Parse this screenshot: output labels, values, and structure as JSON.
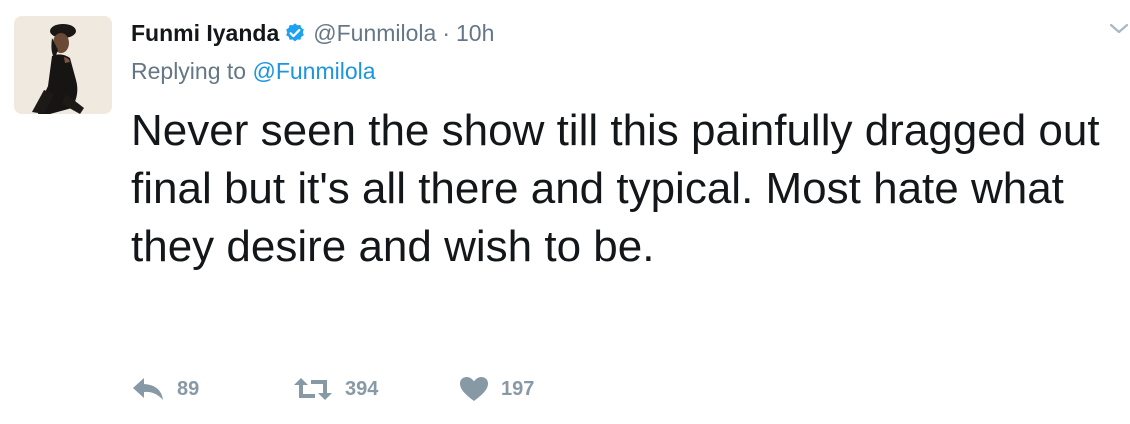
{
  "author": {
    "name": "Funmi Iyanda",
    "handle": "@Funmilola",
    "time": "10h",
    "verified": true
  },
  "reply_context": {
    "prefix": "Replying to",
    "mention": "@Funmilola"
  },
  "tweet_text": "Never seen the show till this painfully dragged out final but it's all there and typical. Most hate what they desire and wish to be.",
  "actions": {
    "reply_count": "89",
    "retweet_count": "394",
    "like_count": "197"
  },
  "colors": {
    "text": "#14171a",
    "secondary": "#657786",
    "link": "#1b95e0",
    "action_icon": "#8899a6",
    "verified_badge": "#1da1f2"
  },
  "icons": {
    "verified": "verified-badge-icon",
    "caret": "chevron-down-icon",
    "reply": "reply-arrow-icon",
    "retweet": "retweet-icon",
    "like": "heart-icon"
  }
}
